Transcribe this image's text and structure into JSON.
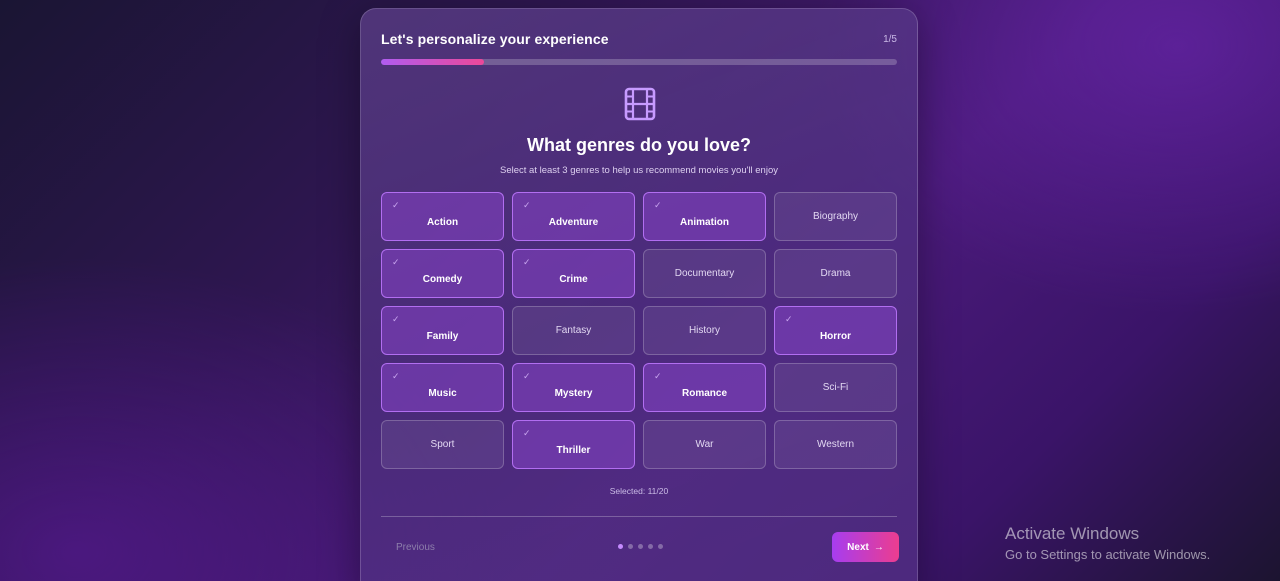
{
  "header": {
    "title": "Let's personalize your experience",
    "step": "1/5",
    "progress": 0.2
  },
  "question": {
    "icon": "film-icon",
    "title": "What genres do you love?",
    "subtitle": "Select at least 3 genres to help us recommend movies you'll enjoy"
  },
  "genres": [
    {
      "label": "Action",
      "selected": true
    },
    {
      "label": "Adventure",
      "selected": true
    },
    {
      "label": "Animation",
      "selected": true
    },
    {
      "label": "Biography",
      "selected": false
    },
    {
      "label": "Comedy",
      "selected": true
    },
    {
      "label": "Crime",
      "selected": true
    },
    {
      "label": "Documentary",
      "selected": false
    },
    {
      "label": "Drama",
      "selected": false
    },
    {
      "label": "Family",
      "selected": true
    },
    {
      "label": "Fantasy",
      "selected": false
    },
    {
      "label": "History",
      "selected": false
    },
    {
      "label": "Horror",
      "selected": true
    },
    {
      "label": "Music",
      "selected": true
    },
    {
      "label": "Mystery",
      "selected": true
    },
    {
      "label": "Romance",
      "selected": true
    },
    {
      "label": "Sci-Fi",
      "selected": false
    },
    {
      "label": "Sport",
      "selected": false
    },
    {
      "label": "Thriller",
      "selected": true
    },
    {
      "label": "War",
      "selected": false
    },
    {
      "label": "Western",
      "selected": false
    }
  ],
  "check_glyph": "✓",
  "selected_text": "Selected: 11/20",
  "footer": {
    "previous_label": "Previous",
    "next_label": "Next",
    "next_icon": "→",
    "dots_total": 5,
    "dots_active": 0
  },
  "watermark": {
    "title": "Activate Windows",
    "subtitle": "Go to Settings to activate Windows."
  },
  "colors": {
    "accent_start": "#a63df0",
    "accent_end": "#ec3d8f",
    "selected_border": "#be78ff"
  }
}
